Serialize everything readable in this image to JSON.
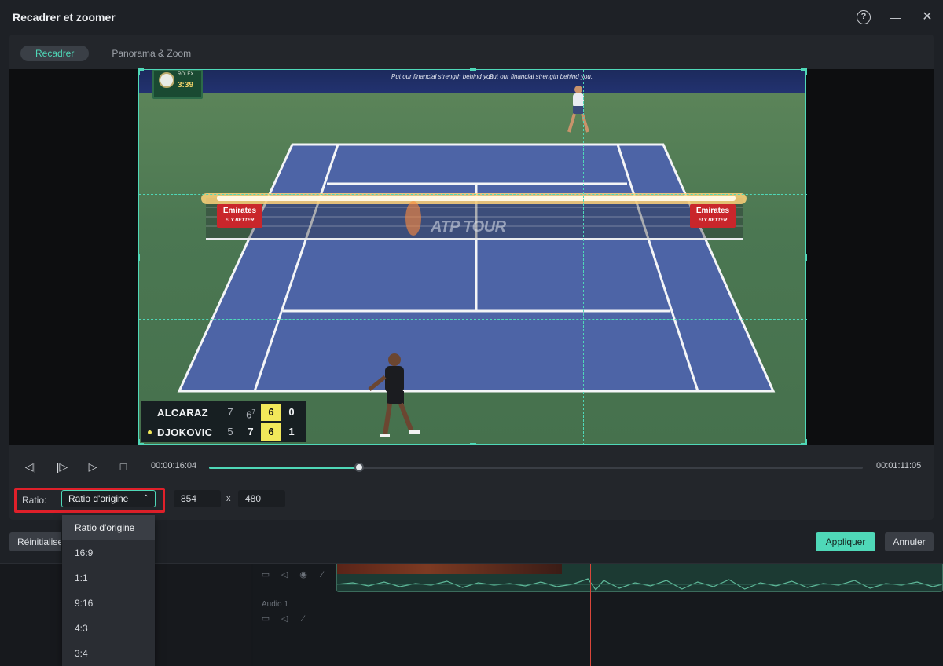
{
  "dialog": {
    "title": "Recadrer et zoomer",
    "tabs": [
      {
        "label": "Recadrer",
        "active": true
      },
      {
        "label": "Panorama & Zoom",
        "active": false
      }
    ]
  },
  "preview": {
    "clock_brand": "ROLEX",
    "clock_time": "3:39",
    "sponsor_text": "Put our financial strength behind you.",
    "banner_brand": "Emirates",
    "banner_tagline": "FLY BETTER",
    "court_logo": "ATP TOUR",
    "scoreboard": [
      {
        "name": "ALCARAZ",
        "set1": "7",
        "set2": "6",
        "set2_tb": "7",
        "set3": "6",
        "points": "0",
        "serving": false
      },
      {
        "name": "DJOKOVIC",
        "set1": "5",
        "set2": "7",
        "set3": "6",
        "points": "1",
        "serving": true
      }
    ]
  },
  "transport": {
    "current_time": "00:00:16:04",
    "total_time": "00:01:11:05",
    "progress": 0.23
  },
  "ratio": {
    "label": "Ratio:",
    "selected": "Ratio d'origine",
    "width": "854",
    "height": "480",
    "separator": "x",
    "options": [
      "Ratio d'origine",
      "16:9",
      "1:1",
      "9:16",
      "4:3",
      "3:4"
    ]
  },
  "footer": {
    "reset_label": "Réinitialiser",
    "apply_label": "Appliquer",
    "cancel_label": "Annuler"
  },
  "timeline": {
    "audio_track_label": "Audio 1"
  },
  "colors": {
    "accent": "#4fd8b8",
    "highlight_box": "#e0202a",
    "dialog_bg": "#1e2126"
  }
}
